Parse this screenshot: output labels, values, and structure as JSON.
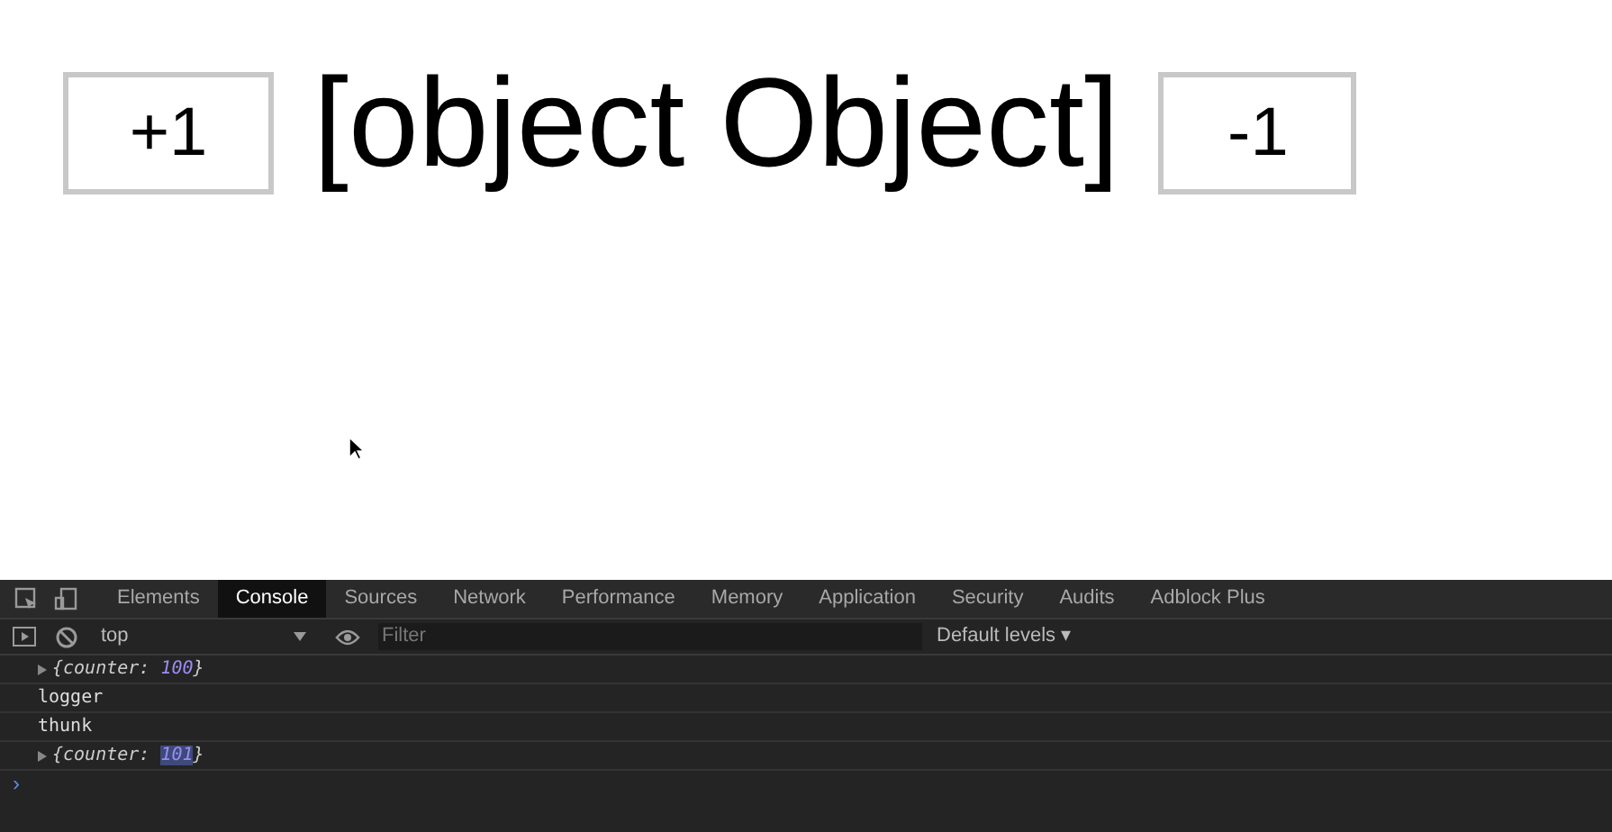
{
  "page": {
    "increment_button": "+1",
    "counter_text": "[object Object]",
    "decrement_button": "-1"
  },
  "devtools": {
    "tabs": [
      {
        "label": "Elements",
        "selected": false
      },
      {
        "label": "Console",
        "selected": true
      },
      {
        "label": "Sources",
        "selected": false
      },
      {
        "label": "Network",
        "selected": false
      },
      {
        "label": "Performance",
        "selected": false
      },
      {
        "label": "Memory",
        "selected": false
      },
      {
        "label": "Application",
        "selected": false
      },
      {
        "label": "Security",
        "selected": false
      },
      {
        "label": "Audits",
        "selected": false
      },
      {
        "label": "Adblock Plus",
        "selected": false
      }
    ],
    "context": "top",
    "filter_placeholder": "Filter",
    "levels": "Default levels ▾",
    "lines": [
      {
        "kind": "object",
        "open": "{counter: ",
        "value": "100",
        "close": "}",
        "highlighted": false
      },
      {
        "kind": "text",
        "text": "logger"
      },
      {
        "kind": "text",
        "text": "thunk"
      },
      {
        "kind": "object",
        "open": "{counter: ",
        "value": "101",
        "close": "}",
        "highlighted": true
      }
    ],
    "prompt": "›"
  }
}
